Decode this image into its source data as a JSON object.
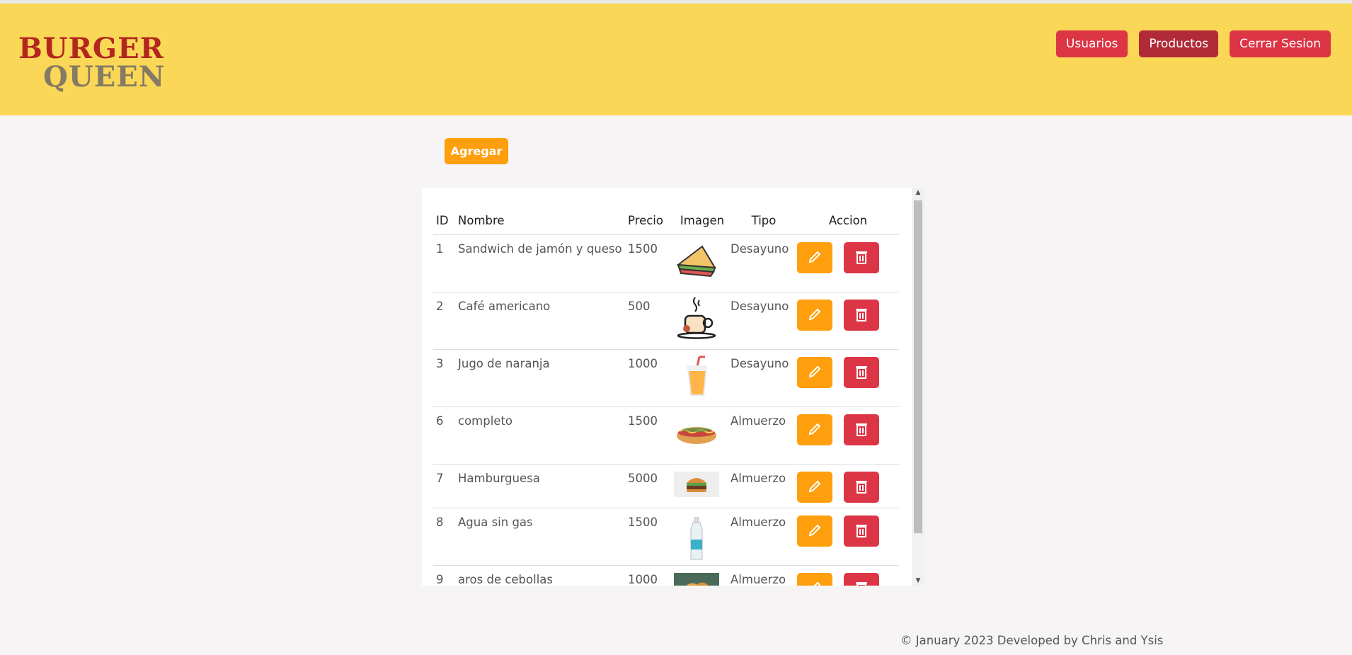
{
  "brand": {
    "line1": "BURGER",
    "line2": "QUEEN"
  },
  "nav": [
    {
      "label": "Usuarios",
      "active": false
    },
    {
      "label": "Productos",
      "active": true
    },
    {
      "label": "Cerrar Sesion",
      "active": false
    }
  ],
  "add_label": "Agregar",
  "table": {
    "headers": {
      "id": "ID",
      "name": "Nombre",
      "price": "Precio",
      "image": "Imagen",
      "type": "Tipo",
      "action": "Accion"
    },
    "rows": [
      {
        "id": "1",
        "name": "Sandwich de jamón y queso",
        "price": "1500",
        "type": "Desayuno",
        "icon": "sandwich-icon"
      },
      {
        "id": "2",
        "name": "Café americano",
        "price": "500",
        "type": "Desayuno",
        "icon": "coffee-cup-icon"
      },
      {
        "id": "3",
        "name": "Jugo de naranja",
        "price": "1000",
        "type": "Desayuno",
        "icon": "juice-icon"
      },
      {
        "id": "6",
        "name": "completo",
        "price": "1500",
        "type": "Almuerzo",
        "icon": "hotdog-icon"
      },
      {
        "id": "7",
        "name": "Hamburguesa",
        "price": "5000",
        "type": "Almuerzo",
        "icon": "burger-icon"
      },
      {
        "id": "8",
        "name": "Agua sin gas",
        "price": "1500",
        "type": "Almuerzo",
        "icon": "water-bottle-icon"
      },
      {
        "id": "9",
        "name": "aros de cebollas",
        "price": "1000",
        "type": "Almuerzo",
        "icon": "onion-rings-icon"
      }
    ]
  },
  "footer": "© January 2023 Developed by Chris and Ysis"
}
